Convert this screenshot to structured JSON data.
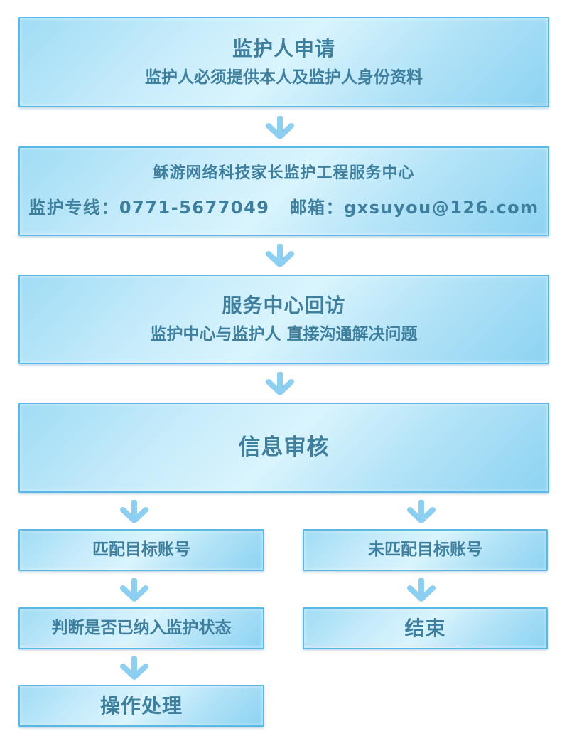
{
  "steps": {
    "apply": {
      "title": "监护人申请",
      "desc": "监护人必须提供本人及监护人身份资料"
    },
    "center": {
      "name": "稣游网络科技家长监护工程服务中心",
      "hotline_label": "监护专线：",
      "hotline": "0771-5677049",
      "email_label": "邮箱：",
      "email": "gxsuyou@126.com"
    },
    "callback": {
      "title": "服务中心回访",
      "desc": "监护中心与监护人 直接沟通解决问题"
    },
    "review": {
      "title": "信息审核"
    }
  },
  "branches": {
    "matched": {
      "label": "匹配目标账号",
      "next": "判断是否已纳入监护状态",
      "final": "操作处理"
    },
    "unmatched": {
      "label": "未匹配目标账号",
      "final": "结束"
    }
  },
  "colors": {
    "border": "#5bb8e6",
    "text": "#3f7f9e",
    "arrow": "#8ccff0"
  },
  "icons": {
    "arrow": "down-arrow-icon"
  }
}
